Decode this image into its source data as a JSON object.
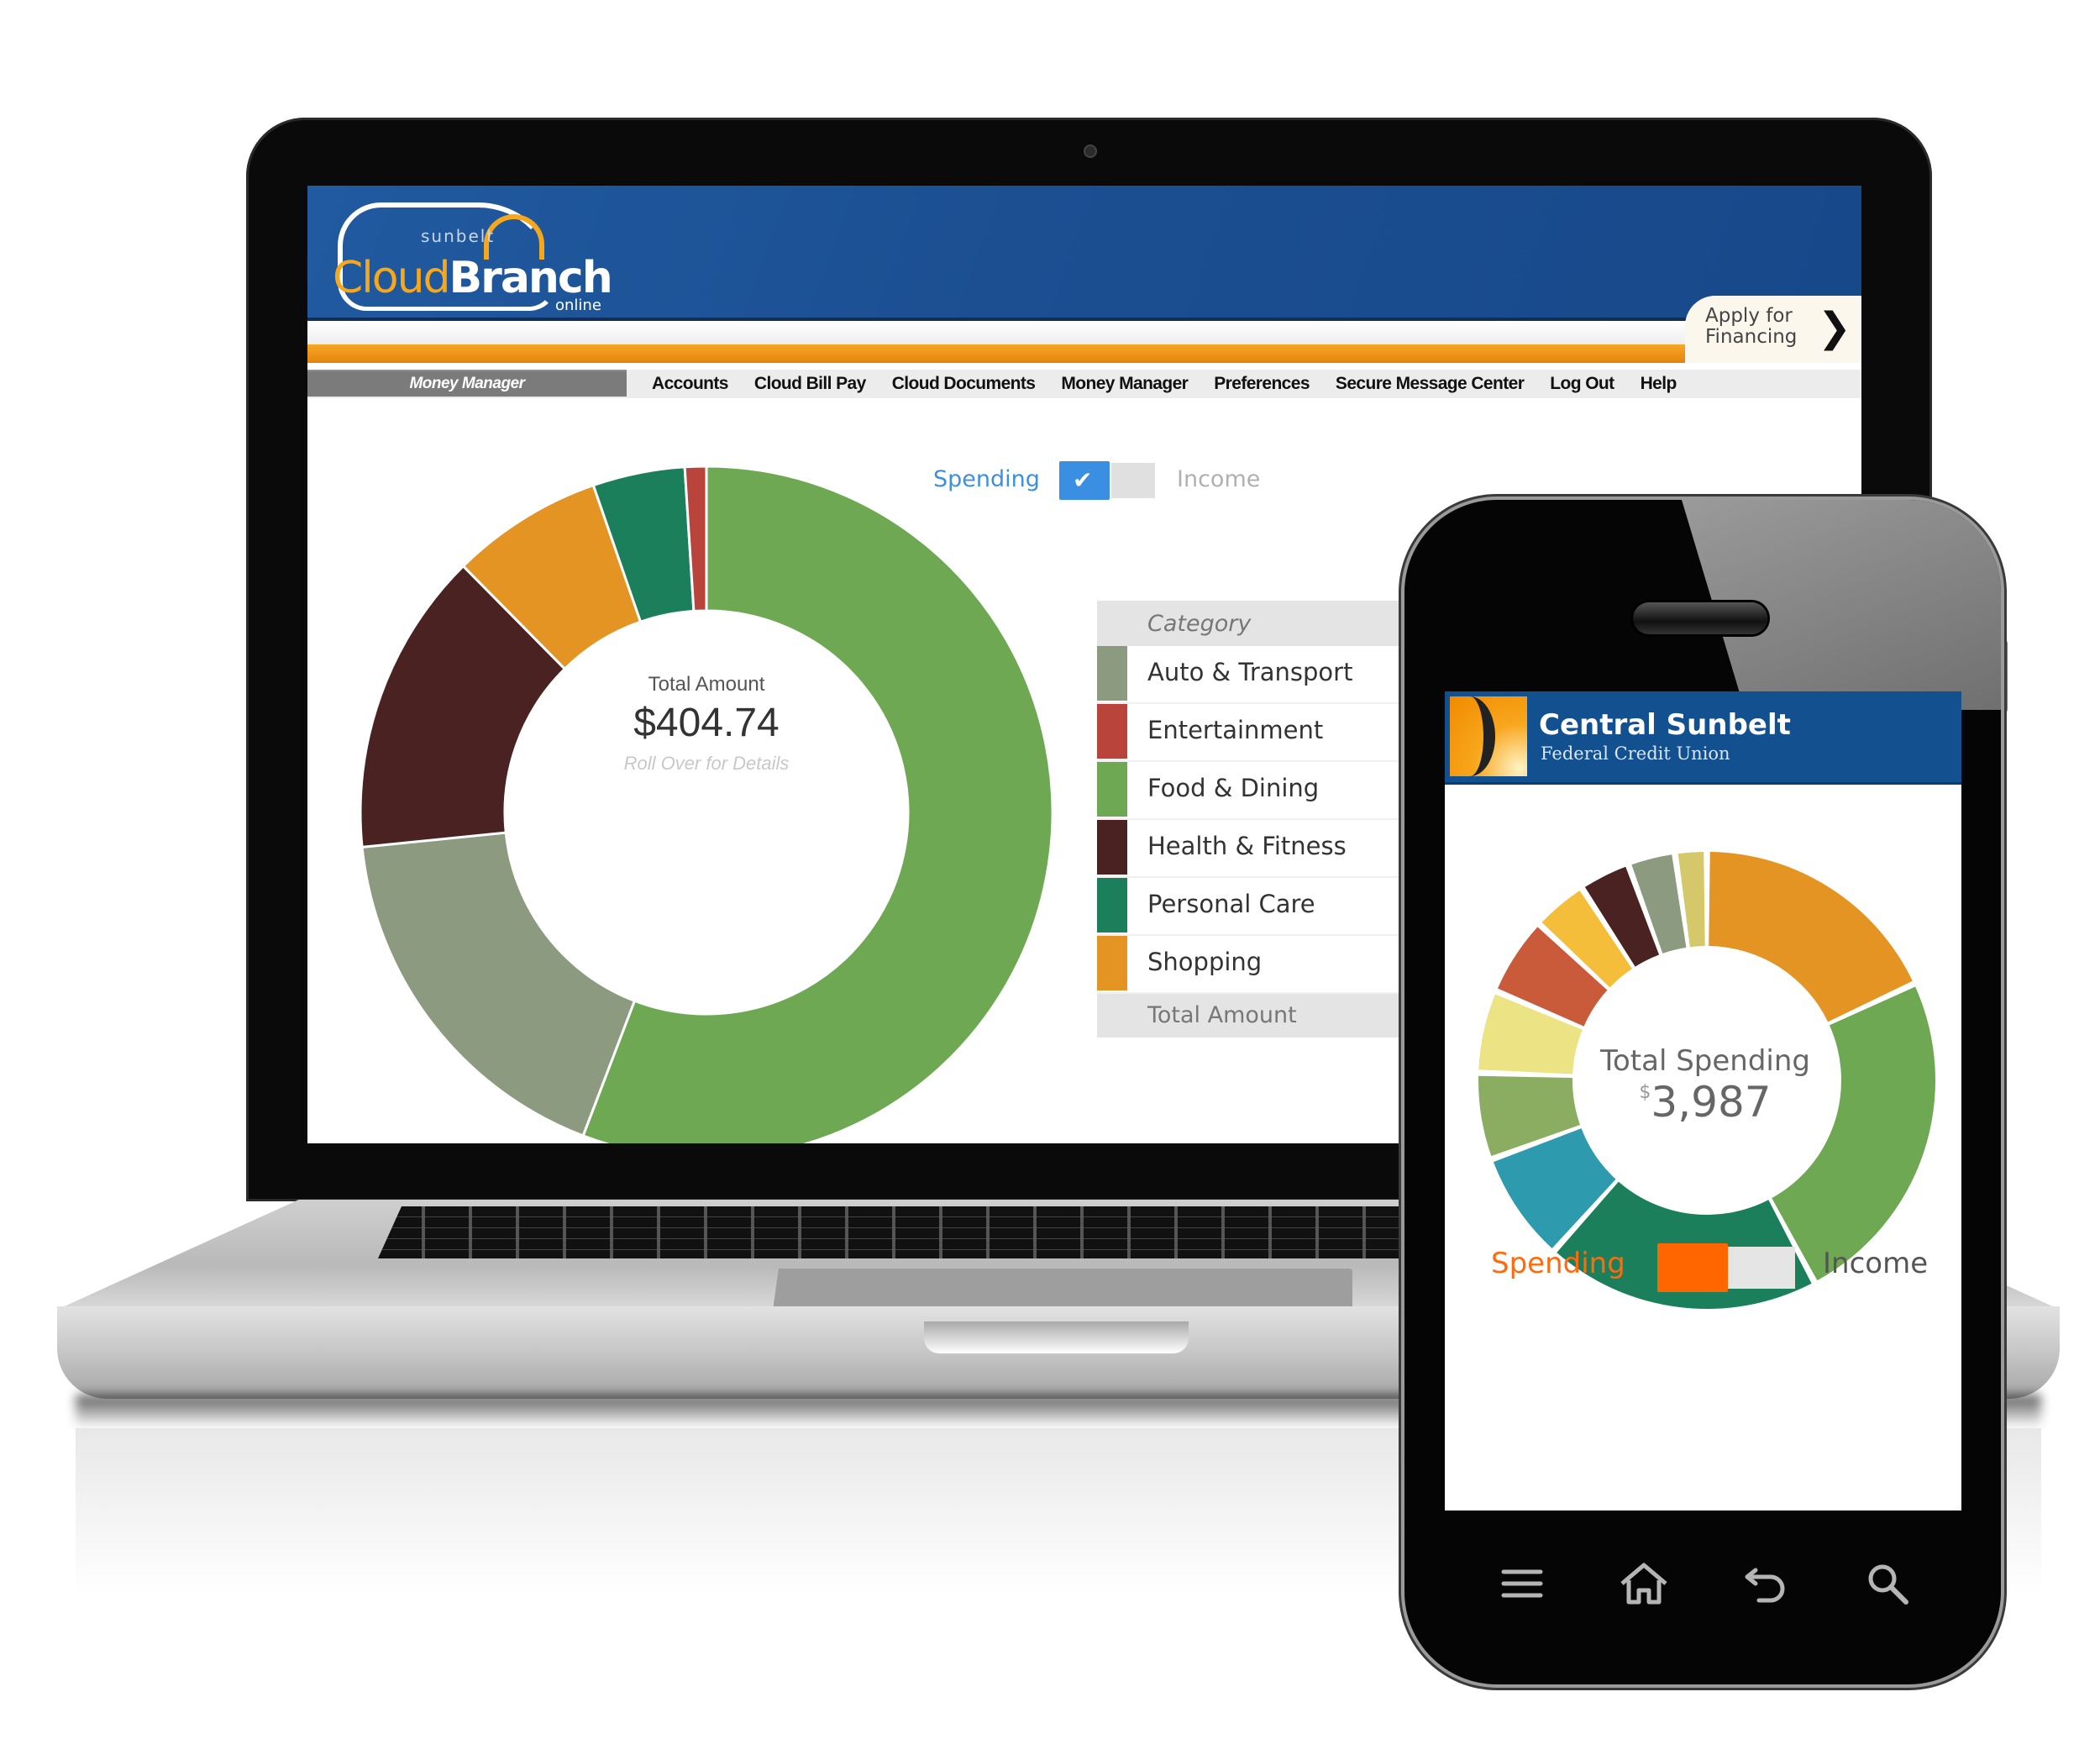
{
  "laptop": {
    "header": {
      "logo": {
        "top": "sunbelt",
        "part1": "Cloud",
        "part2": "Branch",
        "bottom": "online"
      },
      "apply_button": {
        "line1": "Apply for",
        "line2": "Financing",
        "icon": "chevron-right-icon"
      }
    },
    "nav": {
      "current_section": "Money Manager",
      "items": [
        "Accounts",
        "Cloud Bill Pay",
        "Cloud Documents",
        "Money Manager",
        "Preferences",
        "Secure Message Center",
        "Log Out",
        "Help"
      ]
    },
    "toggle": {
      "on_label": "Spending",
      "off_label": "Income",
      "selected": "Spending",
      "check_icon": "checkmark-icon",
      "on_color": "#3b8fe3"
    },
    "donut_center": {
      "label": "Total Amount",
      "value": "$404.74",
      "hint": "Roll Over for Details"
    },
    "legend": {
      "header": "Category",
      "footer": "Total Amount",
      "rows": [
        {
          "label": "Auto & Transport",
          "color": "#8c9a80"
        },
        {
          "label": "Entertainment",
          "color": "#b8443c"
        },
        {
          "label": "Food & Dining",
          "color": "#6ea852"
        },
        {
          "label": "Health & Fitness",
          "color": "#4a2222"
        },
        {
          "label": "Personal Care",
          "color": "#1b7f5c"
        },
        {
          "label": "Shopping",
          "color": "#e39422"
        }
      ]
    }
  },
  "phone": {
    "header": {
      "title": "Central Sunbelt",
      "subtitle": "Federal Credit Union"
    },
    "donut_center": {
      "label": "Total Spending",
      "currency": "$",
      "value": "3,987"
    },
    "toggle": {
      "on_label": "Spending",
      "off_label": "Income",
      "selected": "Spending",
      "on_color": "#ff6600"
    },
    "nav_icons": [
      "menu-icon",
      "home-icon",
      "back-icon",
      "search-icon"
    ]
  },
  "chart_data": [
    {
      "type": "pie",
      "title": "Total Amount",
      "total": 404.74,
      "start": "top, clockwise",
      "categories": [
        "Food & Dining",
        "Auto & Transport",
        "Health & Fitness",
        "Shopping",
        "Personal Care",
        "Entertainment"
      ],
      "values": [
        225.85,
        71.23,
        57.47,
        28.74,
        17.4,
        4.05
      ],
      "colors": [
        "#6ea852",
        "#8c9a80",
        "#4a2222",
        "#e39422",
        "#1b7f5c",
        "#b8443c"
      ],
      "legend_position": "right"
    },
    {
      "type": "pie",
      "title": "Total Spending",
      "total": 3987,
      "start": "top, clockwise",
      "categories": [
        "slice-1",
        "slice-2",
        "slice-3",
        "slice-4",
        "slice-5",
        "slice-6",
        "slice-7",
        "slice-8",
        "slice-9",
        "slice-10",
        "slice-11"
      ],
      "values": [
        720,
        963,
        775,
        310,
        244,
        233,
        222,
        155,
        144,
        133,
        89
      ],
      "colors": [
        "#e39422",
        "#6ea852",
        "#1b7f5c",
        "#2e9aad",
        "#8aad62",
        "#ece384",
        "#c95a3a",
        "#f4bd3a",
        "#4a2222",
        "#8c9a80",
        "#d4c86a"
      ],
      "legend_position": "none"
    }
  ]
}
